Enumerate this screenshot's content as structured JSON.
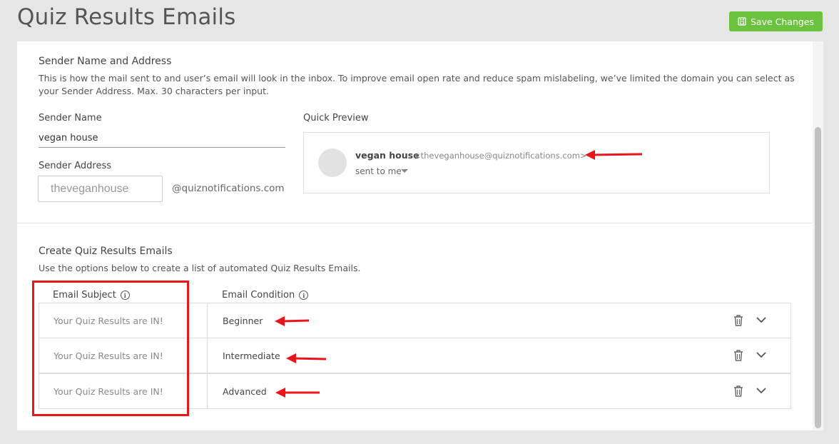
{
  "header": {
    "title": "Quiz Results Emails",
    "save_label": "Save Changes"
  },
  "sender": {
    "section_title": "Sender Name and Address",
    "description": "This is how the mail sent to and user’s email will look in the inbox. To improve email open rate and reduce spam mislabeling, we’ve limited the domain you can select as your Sender Address. Max. 30 characters per input.",
    "name_label": "Sender Name",
    "name_value": "vegan house",
    "address_label": "Sender Address",
    "address_placeholder": "theveganhouse",
    "domain_suffix": "@quiznotifications.com"
  },
  "preview": {
    "label": "Quick Preview",
    "sender_name": "vegan house",
    "sender_email": "<theveganhouse@quiznotifications.com>",
    "sent_to": "sent to me"
  },
  "emails": {
    "section_title": "Create Quiz Results Emails",
    "description": "Use the options below to create a list of automated Quiz Results Emails.",
    "col_subject": "Email Subject",
    "col_condition": "Email Condition",
    "rows": [
      {
        "subject": "Your Quiz Results are IN!",
        "condition": "Beginner"
      },
      {
        "subject": "Your Quiz Results are IN!",
        "condition": "Intermediate"
      },
      {
        "subject": "Your Quiz Results are IN!",
        "condition": "Advanced"
      }
    ]
  },
  "colors": {
    "accent_green": "#6bc23f",
    "annotation_red": "#e8151b"
  },
  "icons": [
    "save-icon",
    "info-icon",
    "trash-icon",
    "chevron-down-icon",
    "caret-down-icon"
  ]
}
